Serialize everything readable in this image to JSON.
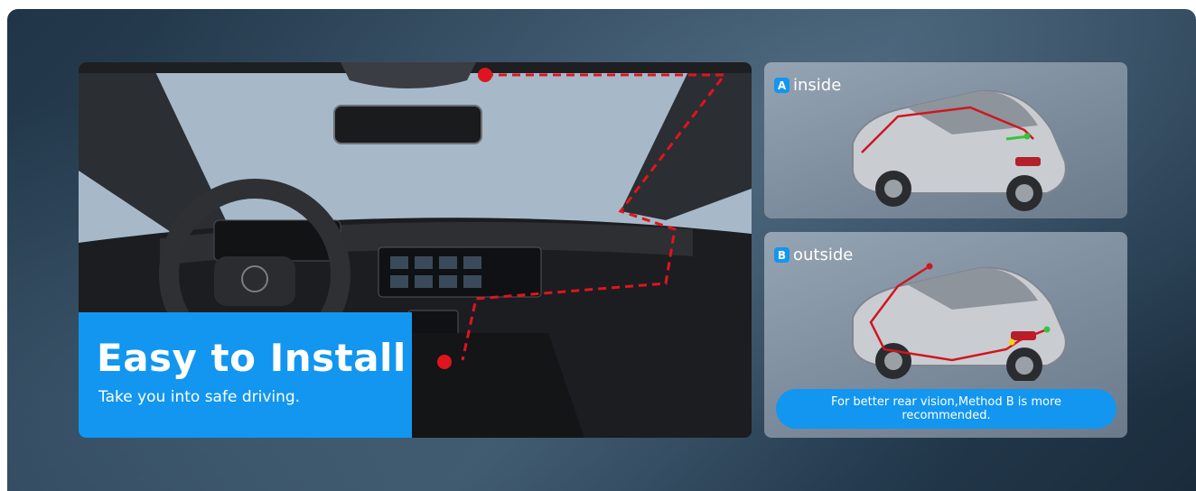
{
  "hero": {
    "title": "Easy to Install",
    "subtitle": "Take you into safe driving."
  },
  "methods": [
    {
      "badge": "A",
      "label": "inside"
    },
    {
      "badge": "B",
      "label": "outside"
    }
  ],
  "recommendation": "For better rear vision,Method B is more recommended.",
  "colors": {
    "accent": "#1296f0",
    "wire_marker": "#e0141e",
    "background": "#2e465a"
  },
  "icons": [
    "car-interior-photo",
    "car-cutaway-inside-icon",
    "car-cutaway-outside-icon"
  ]
}
